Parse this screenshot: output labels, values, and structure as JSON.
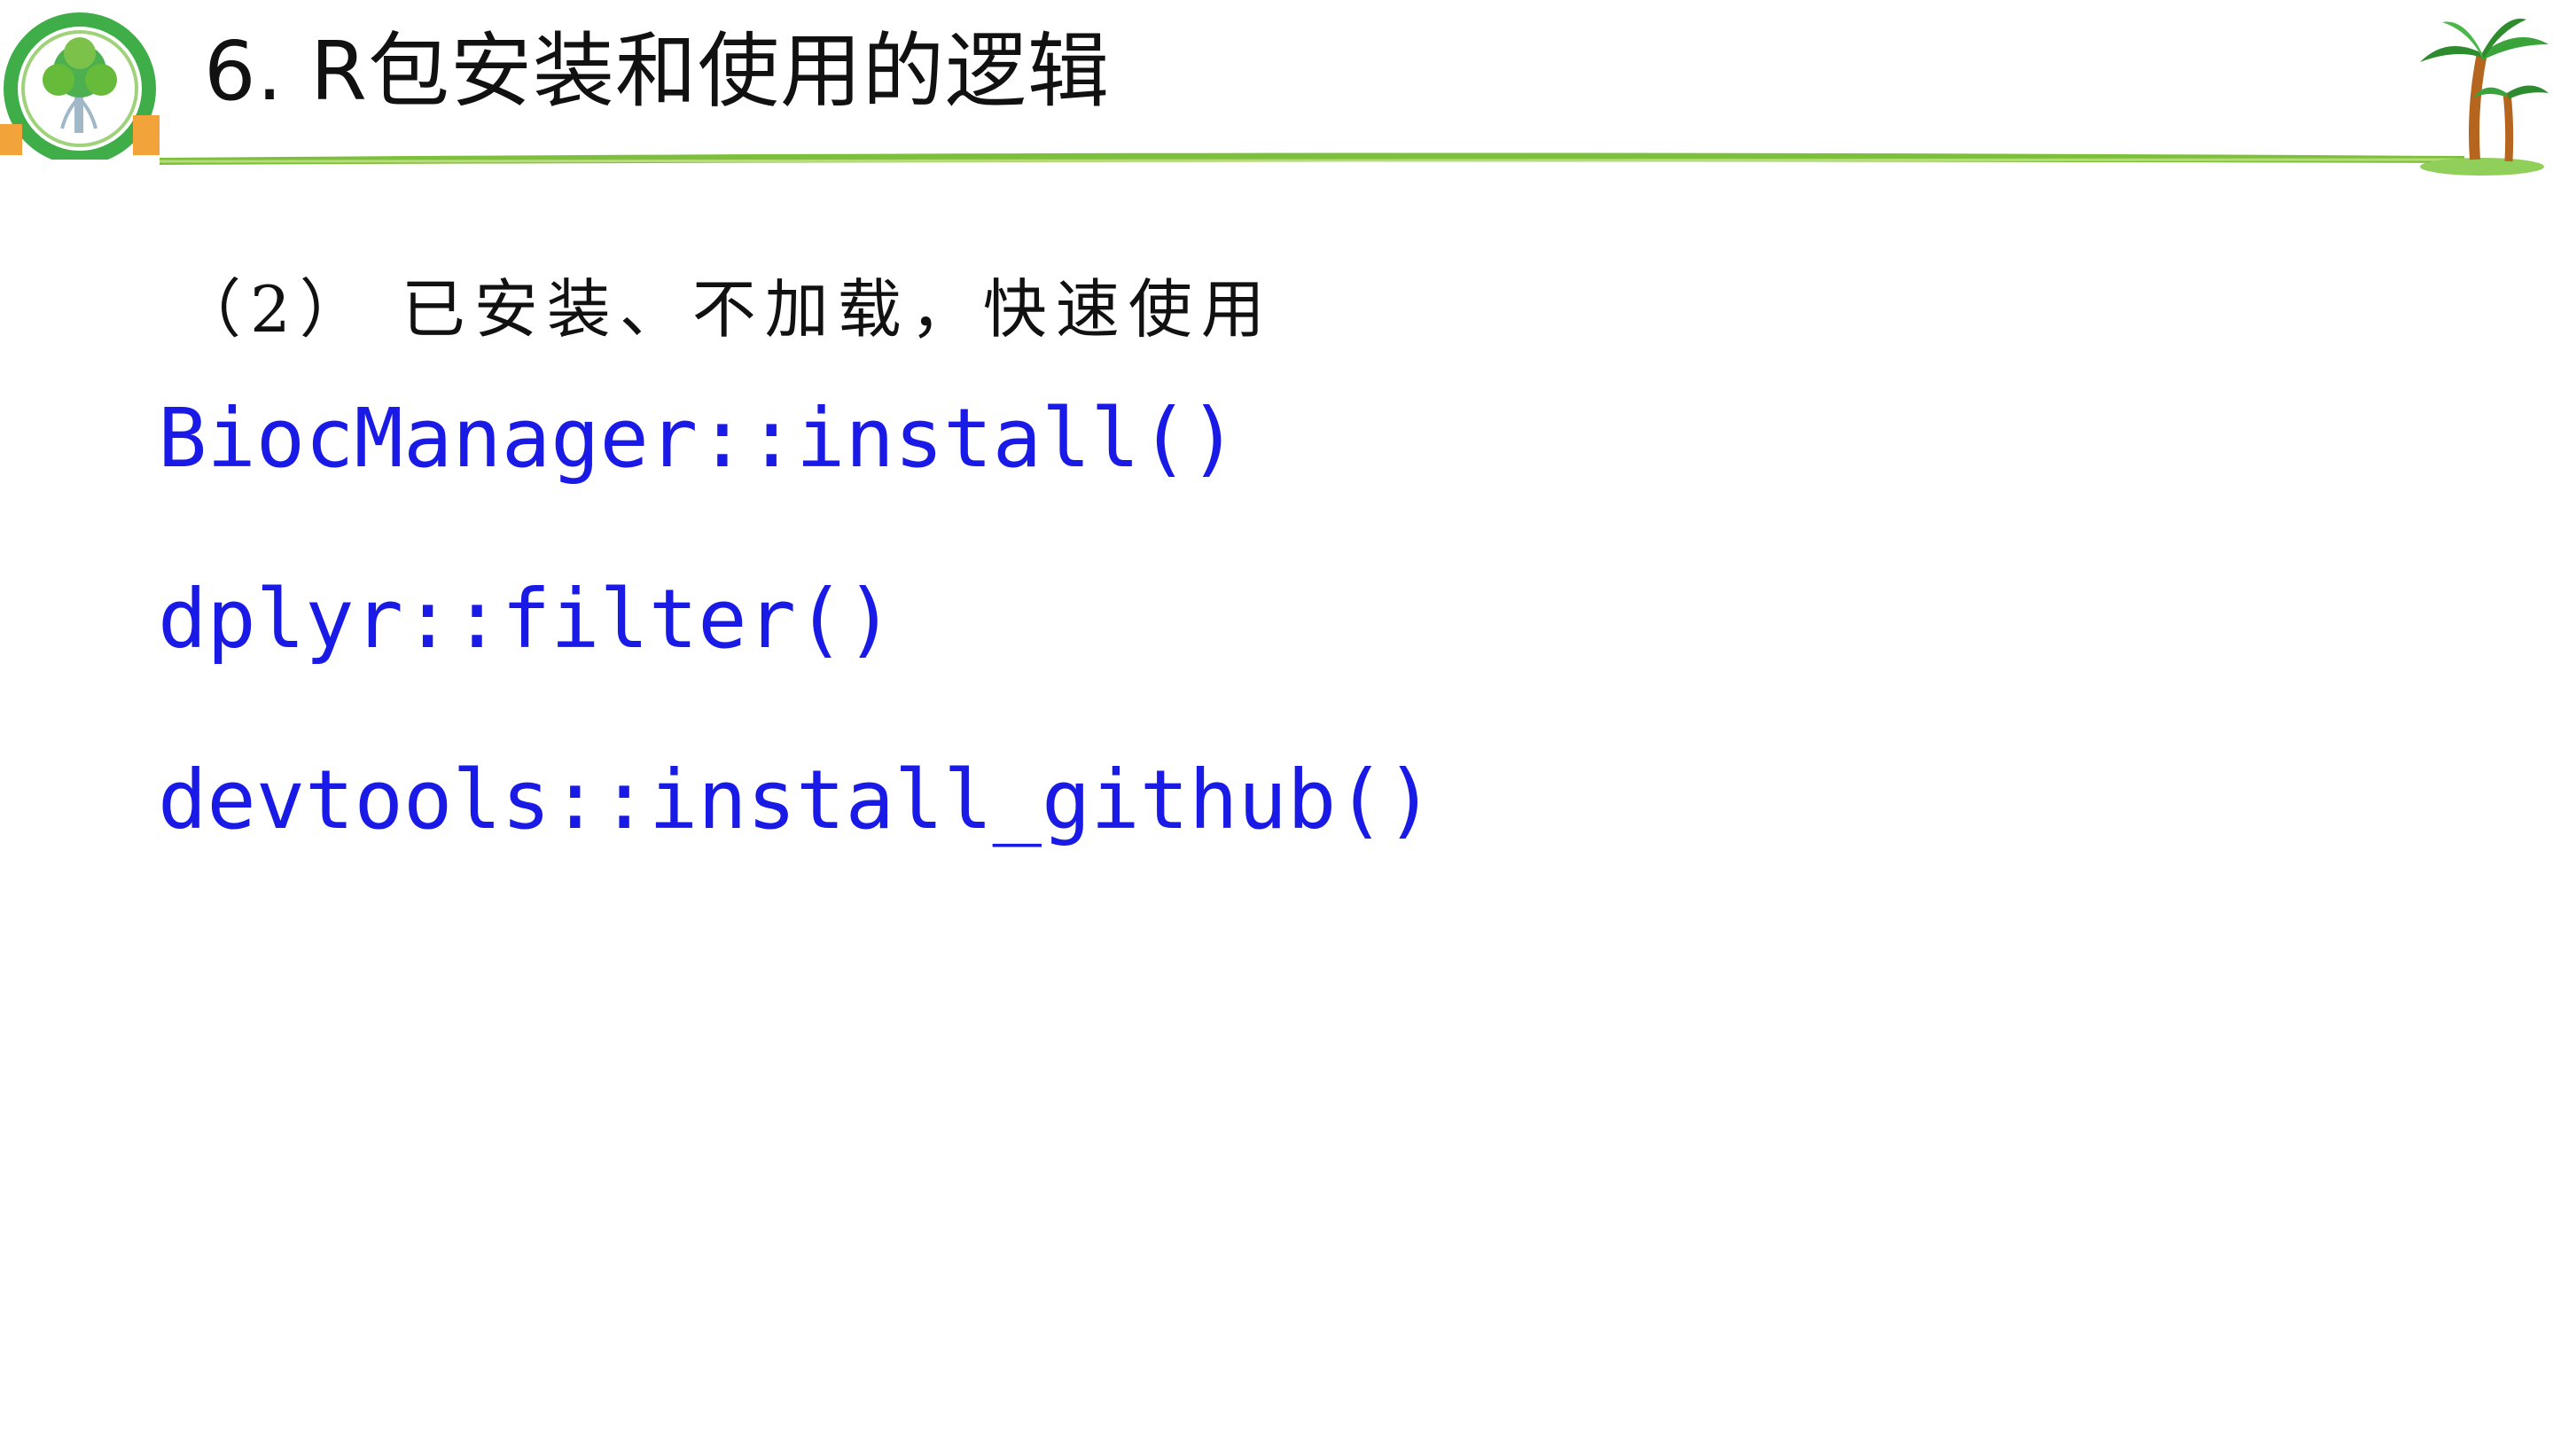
{
  "header": {
    "title": "6. R包安装和使用的逻辑"
  },
  "subtitle": "（2） 已安装、不加载，快速使用",
  "code_lines": [
    "BiocManager::install()",
    "dplyr::filter()",
    "devtools::install_github()"
  ],
  "colors": {
    "code": "#1a1ae6",
    "rule": "#7cbf3a",
    "logo_ring": "#4caf50"
  }
}
